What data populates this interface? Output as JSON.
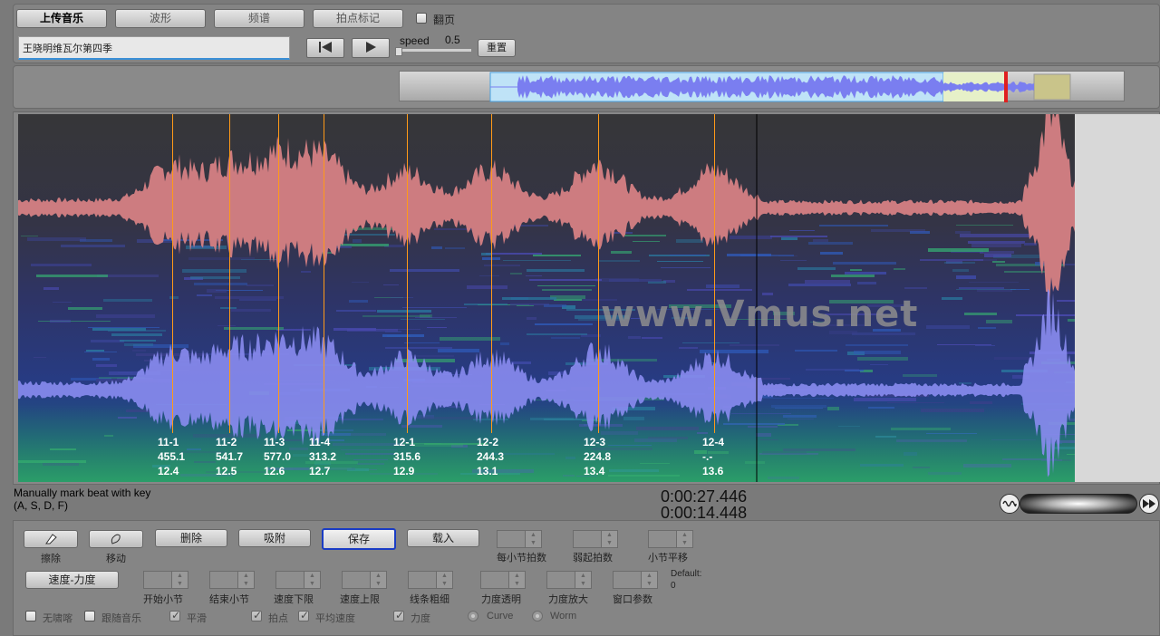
{
  "toolbar": {
    "upload_label": "上传音乐",
    "waveform_label": "波形",
    "spectrum_label": "频谱",
    "beat_mark_label": "拍点标记",
    "page_flip_label": "翻页",
    "track_title": "王晓明维瓦尔第四季",
    "speed_label": "speed",
    "speed_value": "0.5",
    "reset_label": "重置"
  },
  "beats": [
    {
      "name": "11-1",
      "tempo": "455.1",
      "time": "12.4"
    },
    {
      "name": "11-2",
      "tempo": "541.7",
      "time": "12.5"
    },
    {
      "name": "11-3",
      "tempo": "577.0",
      "time": "12.6"
    },
    {
      "name": "11-4",
      "tempo": "313.2",
      "time": "12.7"
    },
    {
      "name": "12-1",
      "tempo": "315.6",
      "time": "12.9"
    },
    {
      "name": "12-2",
      "tempo": "244.3",
      "time": "13.1"
    },
    {
      "name": "12-3",
      "tempo": "224.8",
      "time": "13.4"
    },
    {
      "name": "12-4",
      "tempo": "-.-",
      "time": "13.6"
    }
  ],
  "watermark": "www.Vmus.net",
  "status": {
    "hint_line1": "Manually mark beat with key",
    "hint_line2": "(A, S, D, F)",
    "time_total": "0:00:27.446",
    "time_current": "0:00:14.448"
  },
  "controls": {
    "erase_label": "擦除",
    "move_label": "移动",
    "delete_label": "删除",
    "snap_label": "吸附",
    "save_label": "保存",
    "load_label": "载入",
    "beats_per_bar_label": "每小节拍数",
    "pickup_label": "弱起拍数",
    "bar_shift_label": "小节平移",
    "tempo_dynamics_label": "速度-力度",
    "start_bar_label": "开始小节",
    "end_bar_label": "结束小节",
    "tempo_lower_label": "速度下限",
    "tempo_upper_label": "速度上限",
    "line_width_label": "线条粗细",
    "dyn_transparency_label": "力度透明",
    "dyn_zoom_label": "力度放大",
    "window_param_label": "窗口参数",
    "default_label": "Default:",
    "default_value": "0",
    "no_jitter_label": "无啸喀",
    "follow_music_label": "跟随音乐",
    "smooth_label": "平滑",
    "beat_point_label": "拍点",
    "avg_tempo_label": "平均速度",
    "dynamics_label": "力度",
    "curve_label": "Curve",
    "worm_label": "Worm"
  }
}
